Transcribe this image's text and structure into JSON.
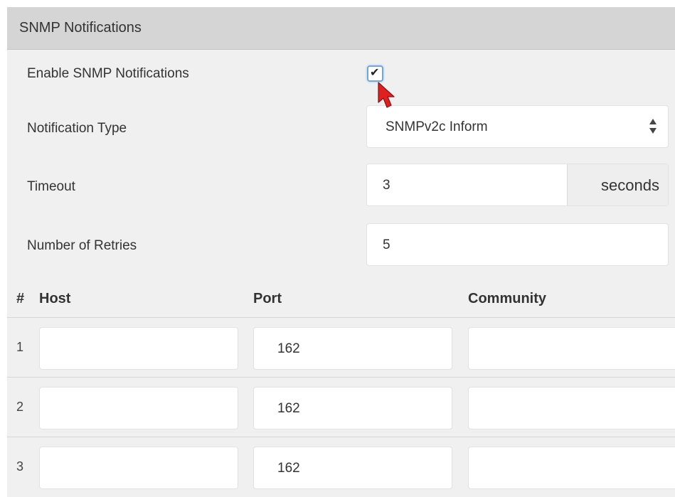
{
  "panel": {
    "title": "SNMP Notifications"
  },
  "form": {
    "enable_label": "Enable SNMP Notifications",
    "enable_checked": true,
    "notification_type_label": "Notification Type",
    "notification_type_value": "SNMPv2c Inform",
    "timeout_label": "Timeout",
    "timeout_value": "3",
    "timeout_unit": "seconds",
    "retries_label": "Number of Retries",
    "retries_value": "5"
  },
  "table": {
    "headers": {
      "num": "#",
      "host": "Host",
      "port": "Port",
      "community": "Community"
    },
    "rows": [
      {
        "num": "1",
        "host": "",
        "port": "162",
        "community": ""
      },
      {
        "num": "2",
        "host": "",
        "port": "162",
        "community": ""
      },
      {
        "num": "3",
        "host": "",
        "port": "162",
        "community": ""
      }
    ]
  },
  "icons": {
    "checkbox_check": "check-icon",
    "select_arrows": "updown-arrows-icon",
    "cursor": "mouse-pointer-icon"
  },
  "colors": {
    "header_bg": "#d5d5d5",
    "panel_bg": "#f0f0f0",
    "cursor_red": "#e02020",
    "checkbox_focus": "#6fa8dc"
  }
}
